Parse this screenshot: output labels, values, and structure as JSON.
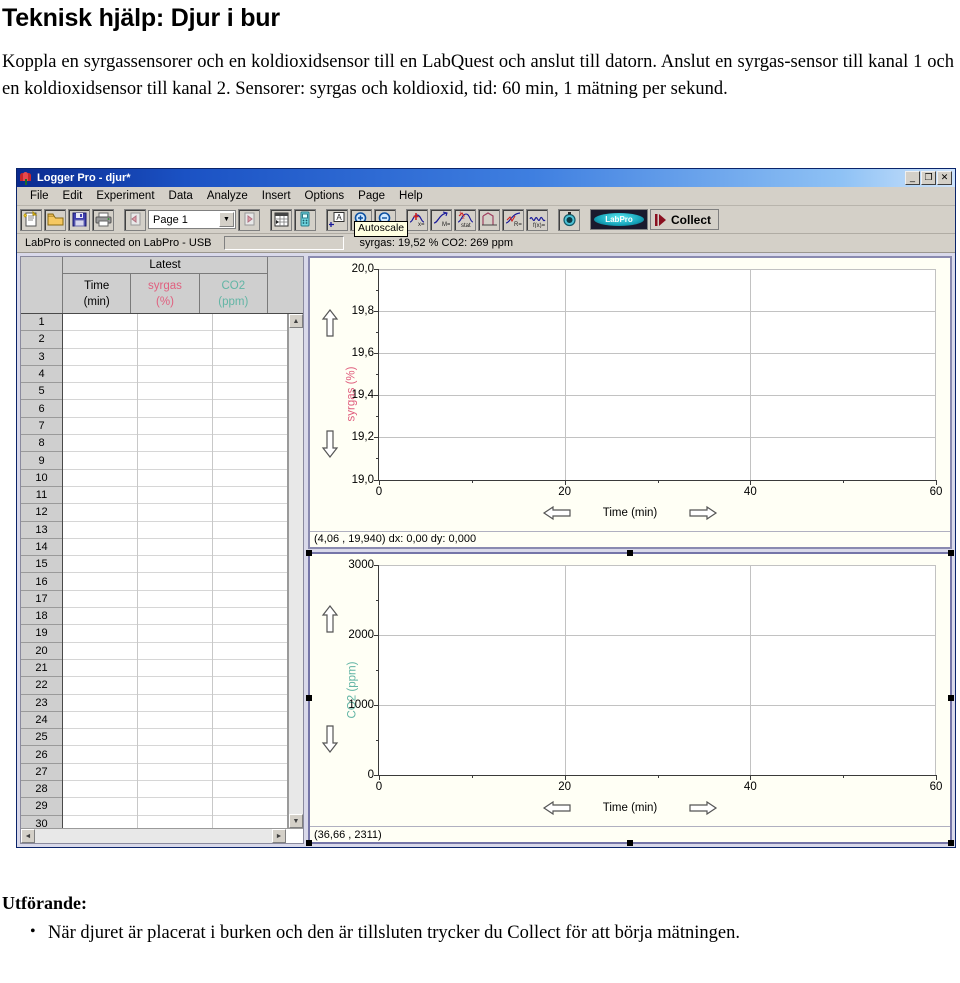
{
  "document": {
    "title": "Teknisk hjälp: Djur i bur",
    "intro": "Koppla en syrgassensorer och en koldioxidsensor till en LabQuest och anslut till datorn. Anslut en syrgas-sensor till kanal 1 och en koldioxidsensor till kanal 2. Sensorer: syrgas och koldioxid, tid: 60 min, 1 mätning per sekund.",
    "bottom_heading": "Utförande:",
    "bullet": "När djuret är placerat i burken och den är tillsluten trycker du Collect för att börja mätningen."
  },
  "window": {
    "title": "Logger Pro - djur*",
    "buttons": {
      "minimize": "_",
      "restore": "❐",
      "close": "✕"
    },
    "menus": [
      "File",
      "Edit",
      "Experiment",
      "Data",
      "Analyze",
      "Insert",
      "Options",
      "Page",
      "Help"
    ],
    "toolbar": {
      "page_value": "Page 1",
      "collect_label": "Collect",
      "labpro_label": "LabPro",
      "tooltip": "Autoscale",
      "icons": [
        "new-document-icon",
        "open-folder-icon",
        "save-disk-icon",
        "print-icon",
        "previous-page-icon",
        "next-page-icon",
        "insert-table-icon",
        "sensor-meter-icon",
        "autoscale-icon",
        "zoom-in-icon",
        "zoom-out-icon",
        "examine-icon",
        "tangent-icon",
        "integral-icon",
        "statistics-icon",
        "curve-fit-icon",
        "model-icon",
        "timer-icon"
      ]
    },
    "status": {
      "connection": "LabPro is connected on LabPro - USB",
      "readout": "syrgas: 19,52 %  CO2: 269 ppm"
    }
  },
  "table": {
    "group_header": "Latest",
    "columns": [
      {
        "name": "Time",
        "unit": "(min)",
        "color": "#000000"
      },
      {
        "name": "syrgas",
        "unit": "(%)",
        "color": "#e0607f"
      },
      {
        "name": "CO2",
        "unit": "(ppm)",
        "color": "#62b5a5"
      }
    ],
    "row_numbers": [
      1,
      2,
      3,
      4,
      5,
      6,
      7,
      8,
      9,
      10,
      11,
      12,
      13,
      14,
      15,
      16,
      17,
      18,
      19,
      20,
      21,
      22,
      23,
      24,
      25,
      26,
      27,
      28,
      29,
      30
    ],
    "cells": []
  },
  "chart_data": [
    {
      "type": "line",
      "title": "",
      "xlabel": "Time (min)",
      "ylabel": "syrgas (%)",
      "ylabel_color": "#e0607f",
      "x_ticks": [
        0,
        20,
        40,
        60
      ],
      "x_tick_labels": [
        "0",
        "20",
        "40",
        "60"
      ],
      "y_ticks": [
        19.0,
        19.2,
        19.4,
        19.6,
        19.8,
        20.0
      ],
      "y_tick_labels": [
        "19,0",
        "19,2",
        "19,4",
        "19,6",
        "19,8",
        "20,0"
      ],
      "xlim": [
        0,
        60
      ],
      "ylim": [
        19.0,
        20.0
      ],
      "grid": true,
      "series": [
        {
          "name": "syrgas",
          "x": [],
          "values": []
        }
      ],
      "status_readout": "(4,06 , 19,940)  dx: 0,00  dy: 0,000",
      "selected": false
    },
    {
      "type": "line",
      "title": "",
      "xlabel": "Time (min)",
      "ylabel": "CO2 (ppm)",
      "ylabel_color": "#62b5a5",
      "x_ticks": [
        0,
        20,
        40,
        60
      ],
      "x_tick_labels": [
        "0",
        "20",
        "40",
        "60"
      ],
      "y_ticks": [
        0,
        1000,
        2000,
        3000
      ],
      "y_tick_labels": [
        "0",
        "1000",
        "2000",
        "3000"
      ],
      "xlim": [
        0,
        60
      ],
      "ylim": [
        0,
        3000
      ],
      "grid": true,
      "series": [
        {
          "name": "CO2",
          "x": [],
          "values": []
        }
      ],
      "status_readout": "(36,66 , 2311)",
      "selected": true
    }
  ]
}
